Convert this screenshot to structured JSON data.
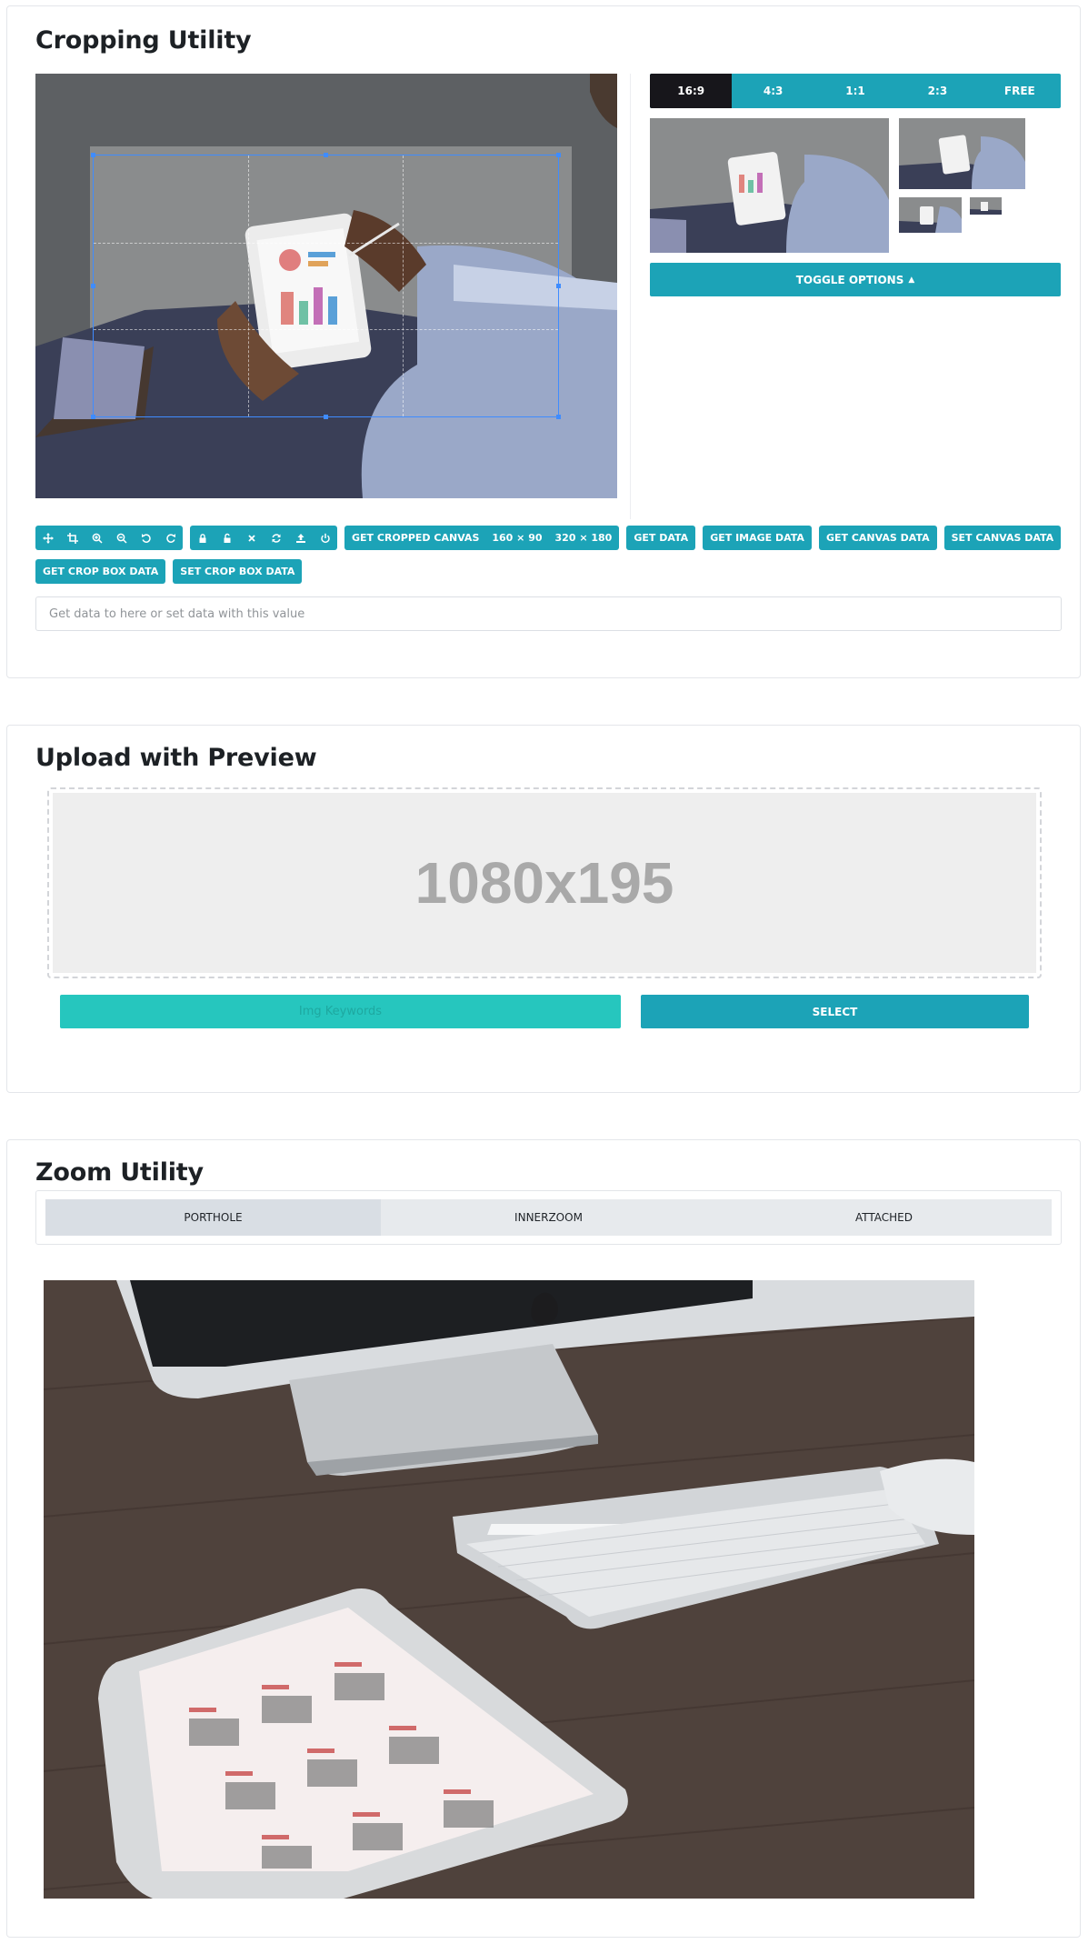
{
  "cropping": {
    "title": "Cropping Utility",
    "ratios": [
      {
        "label": "16:9",
        "active": true
      },
      {
        "label": "4:3",
        "active": false
      },
      {
        "label": "1:1",
        "active": false
      },
      {
        "label": "2:3",
        "active": false
      },
      {
        "label": "FREE",
        "active": false
      }
    ],
    "toggle_label": "TOGGLE OPTIONS",
    "tool_icons_group1": [
      "move-icon",
      "crop-icon",
      "zoom-in-icon",
      "zoom-out-icon",
      "rotate-left-icon",
      "rotate-right-icon"
    ],
    "tool_icons_group2": [
      "lock-icon",
      "unlock-icon",
      "clear-icon",
      "refresh-icon",
      "upload-icon",
      "power-icon"
    ],
    "get_cropped_canvas": "GET CROPPED CANVAS",
    "size_small": "160 × 90",
    "size_large": "320 × 180",
    "get_data": "GET DATA",
    "get_image_data": "GET IMAGE DATA",
    "get_canvas_data": "GET CANVAS DATA",
    "set_canvas_data": "SET CANVAS DATA",
    "get_crop_box_data": "GET CROP BOX DATA",
    "set_crop_box_data": "SET CROP BOX DATA",
    "data_placeholder": "Get data to here or set data with this value",
    "accent_color": "#1ca3b7",
    "active_ratio_color": "#17161b"
  },
  "upload": {
    "title": "Upload with Preview",
    "placeholder_text": "1080x195",
    "keyword_placeholder": "Img Keywords",
    "select_label": "SELECT"
  },
  "zoom": {
    "title": "Zoom Utility",
    "tabs": [
      {
        "label": "PORTHOLE",
        "active": true
      },
      {
        "label": "INNERZOOM",
        "active": false
      },
      {
        "label": "ATTACHED",
        "active": false
      }
    ]
  }
}
